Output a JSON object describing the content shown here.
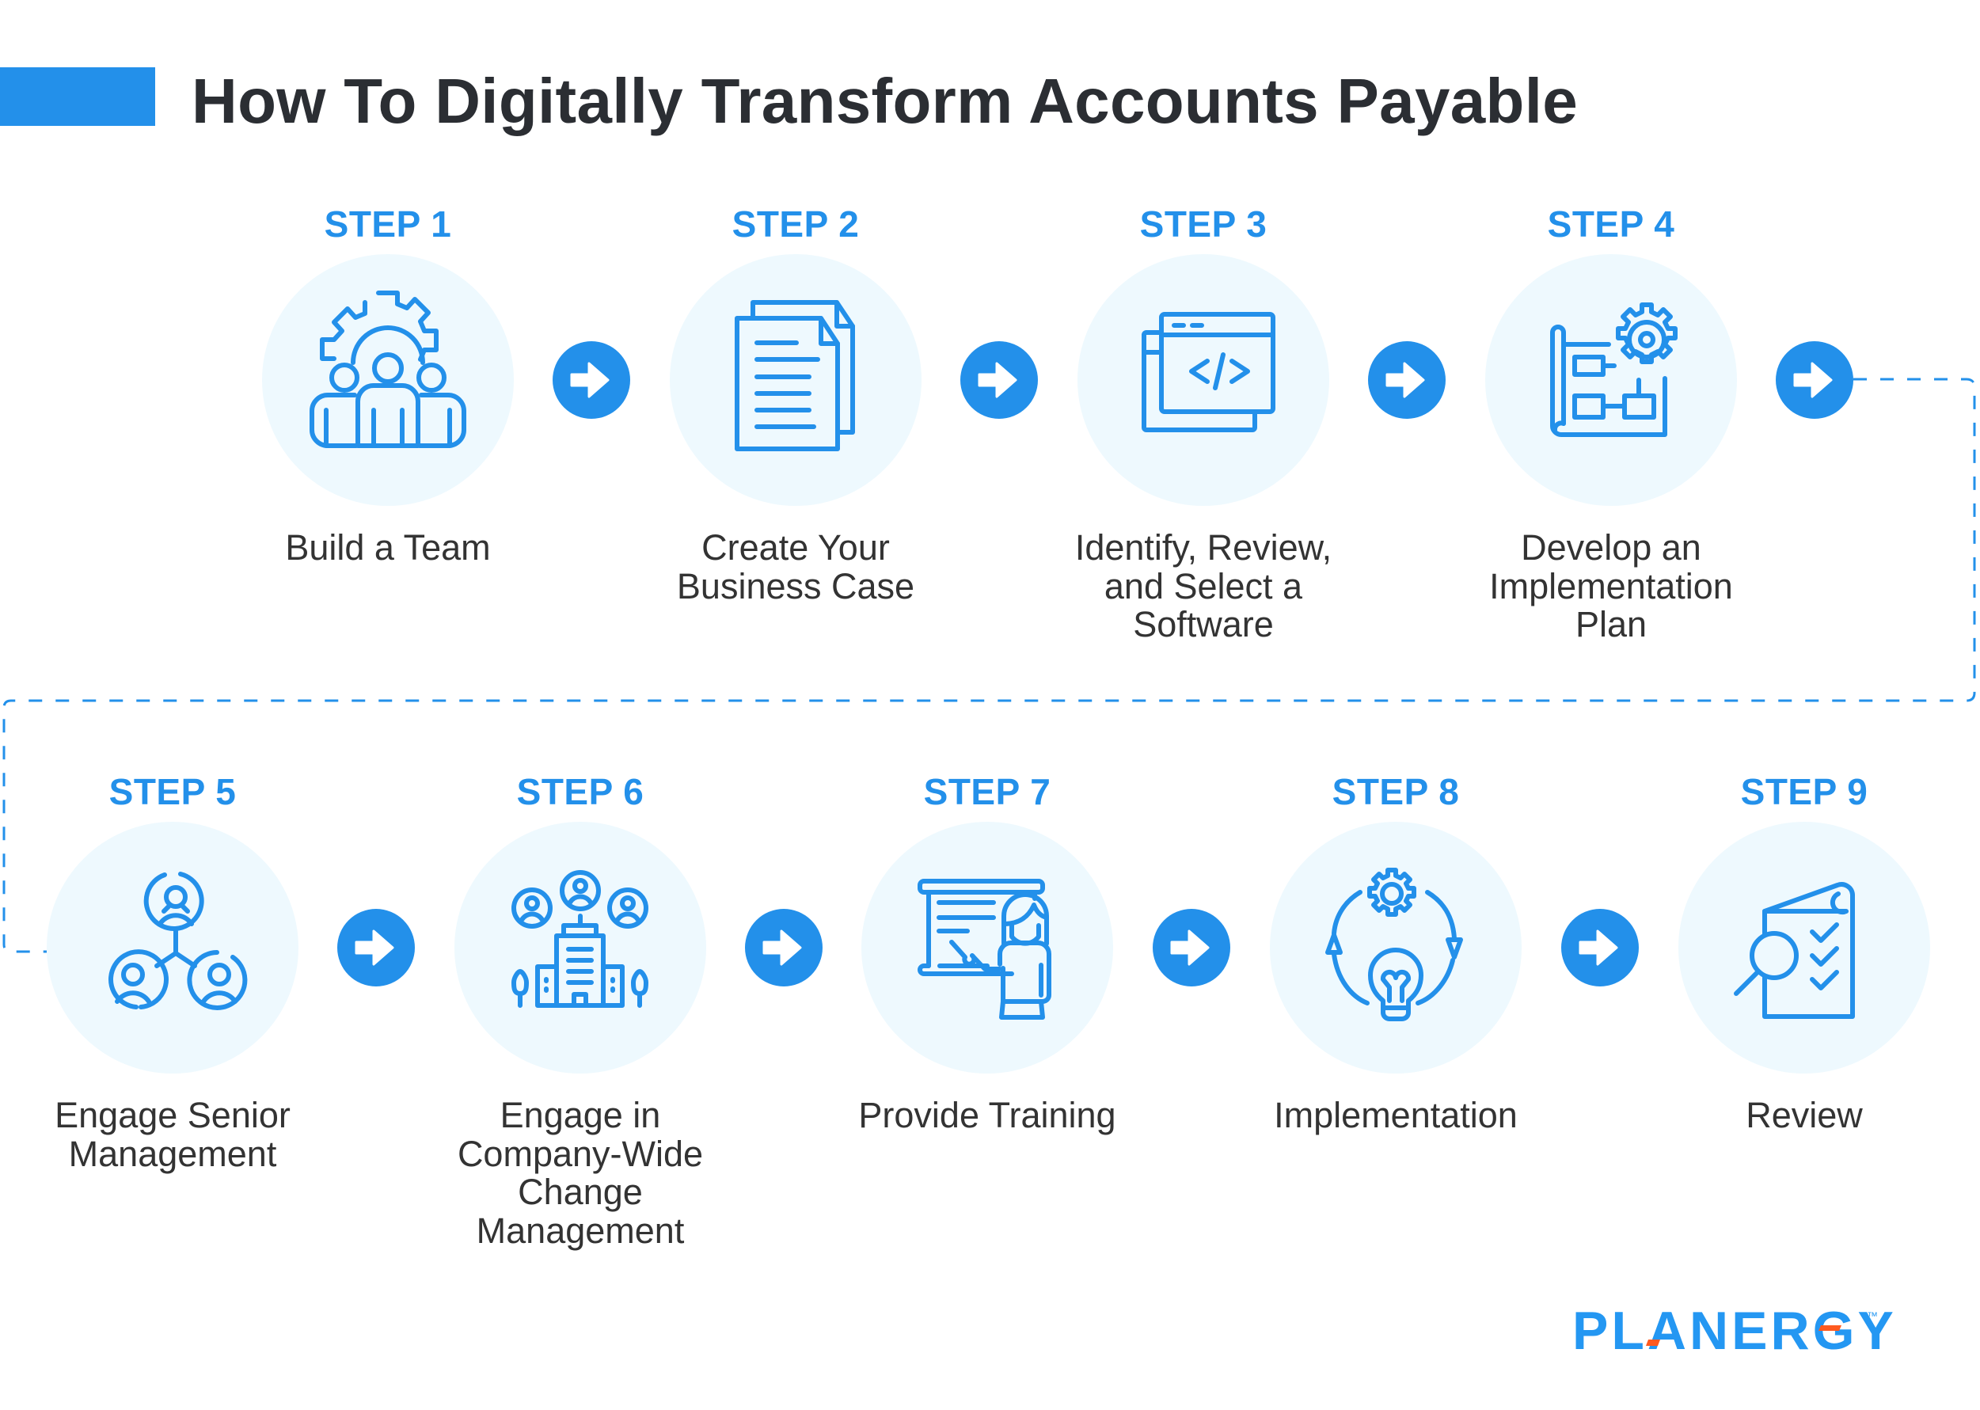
{
  "title": "How To Digitally Transform Accounts Payable",
  "colors": {
    "accent": "#2390EA",
    "circle_bg": "#EEF9FE",
    "title_text": "#2B2E33",
    "body_text": "#333333",
    "logo_accent": "#FF5A1F"
  },
  "steps": [
    {
      "label": "STEP 1",
      "icon": "team-gear-icon",
      "lines": [
        "Build a Team"
      ]
    },
    {
      "label": "STEP 2",
      "icon": "documents-icon",
      "lines": [
        "Create Your",
        "Business Case"
      ]
    },
    {
      "label": "STEP 3",
      "icon": "code-window-icon",
      "lines": [
        "Identify, Review,",
        "and Select a",
        "Software"
      ]
    },
    {
      "label": "STEP 4",
      "icon": "blueprint-gear-icon",
      "lines": [
        "Develop an",
        "Implementation",
        "Plan"
      ]
    },
    {
      "label": "STEP 5",
      "icon": "people-network-icon",
      "lines": [
        "Engage Senior",
        "Management"
      ]
    },
    {
      "label": "STEP 6",
      "icon": "company-people-icon",
      "lines": [
        "Engage in",
        "Company-Wide",
        "Change",
        "Management"
      ]
    },
    {
      "label": "STEP 7",
      "icon": "presentation-training-icon",
      "lines": [
        "Provide Training"
      ]
    },
    {
      "label": "STEP 8",
      "icon": "gear-bulb-cycle-icon",
      "lines": [
        "Implementation"
      ]
    },
    {
      "label": "STEP 9",
      "icon": "document-review-icon",
      "lines": [
        "Review"
      ]
    }
  ],
  "arrow_icon": "arrow-right-icon",
  "logo": {
    "text": "PLANERGY",
    "trademark": "™"
  }
}
